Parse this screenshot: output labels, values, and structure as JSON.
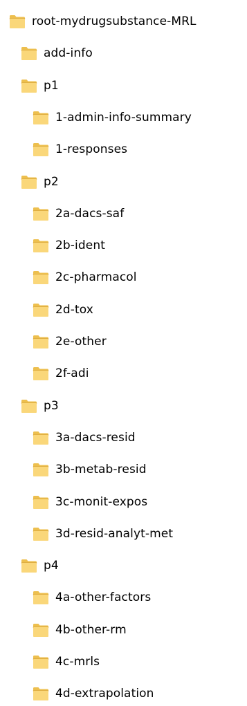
{
  "colors": {
    "folder_back": "#EDBF4E",
    "folder_front": "#FAD77A",
    "folder_edge": "#D9A637",
    "text": "#000000"
  },
  "tree": [
    {
      "id": "root",
      "label": "root-mydrugsubstance-MRL",
      "depth": 0,
      "icon": "folder-icon"
    },
    {
      "id": "add-info",
      "label": "add-info",
      "depth": 1,
      "icon": "folder-icon"
    },
    {
      "id": "p1",
      "label": "p1",
      "depth": 1,
      "icon": "folder-icon"
    },
    {
      "id": "1-admin-info-summary",
      "label": "1-admin-info-summary",
      "depth": 2,
      "icon": "folder-icon"
    },
    {
      "id": "1-responses",
      "label": "1-responses",
      "depth": 2,
      "icon": "folder-icon"
    },
    {
      "id": "p2",
      "label": "p2",
      "depth": 1,
      "icon": "folder-icon"
    },
    {
      "id": "2a-dacs-saf",
      "label": "2a-dacs-saf",
      "depth": 2,
      "icon": "folder-icon"
    },
    {
      "id": "2b-ident",
      "label": "2b-ident",
      "depth": 2,
      "icon": "folder-icon"
    },
    {
      "id": "2c-pharmacol",
      "label": "2c-pharmacol",
      "depth": 2,
      "icon": "folder-icon"
    },
    {
      "id": "2d-tox",
      "label": "2d-tox",
      "depth": 2,
      "icon": "folder-icon"
    },
    {
      "id": "2e-other",
      "label": "2e-other",
      "depth": 2,
      "icon": "folder-icon"
    },
    {
      "id": "2f-adi",
      "label": "2f-adi",
      "depth": 2,
      "icon": "folder-icon"
    },
    {
      "id": "p3",
      "label": "p3",
      "depth": 1,
      "icon": "folder-icon"
    },
    {
      "id": "3a-dacs-resid",
      "label": "3a-dacs-resid",
      "depth": 2,
      "icon": "folder-icon"
    },
    {
      "id": "3b-metab-resid",
      "label": "3b-metab-resid",
      "depth": 2,
      "icon": "folder-icon"
    },
    {
      "id": "3c-monit-expos",
      "label": "3c-monit-expos",
      "depth": 2,
      "icon": "folder-icon"
    },
    {
      "id": "3d-resid-analyt-met",
      "label": "3d-resid-analyt-met",
      "depth": 2,
      "icon": "folder-icon"
    },
    {
      "id": "p4",
      "label": "p4",
      "depth": 1,
      "icon": "folder-icon"
    },
    {
      "id": "4a-other-factors",
      "label": "4a-other-factors",
      "depth": 2,
      "icon": "folder-icon"
    },
    {
      "id": "4b-other-rm",
      "label": "4b-other-rm",
      "depth": 2,
      "icon": "folder-icon"
    },
    {
      "id": "4c-mrls",
      "label": "4c-mrls",
      "depth": 2,
      "icon": "folder-icon"
    },
    {
      "id": "4d-extrapolation",
      "label": "4d-extrapolation",
      "depth": 2,
      "icon": "folder-icon"
    }
  ]
}
